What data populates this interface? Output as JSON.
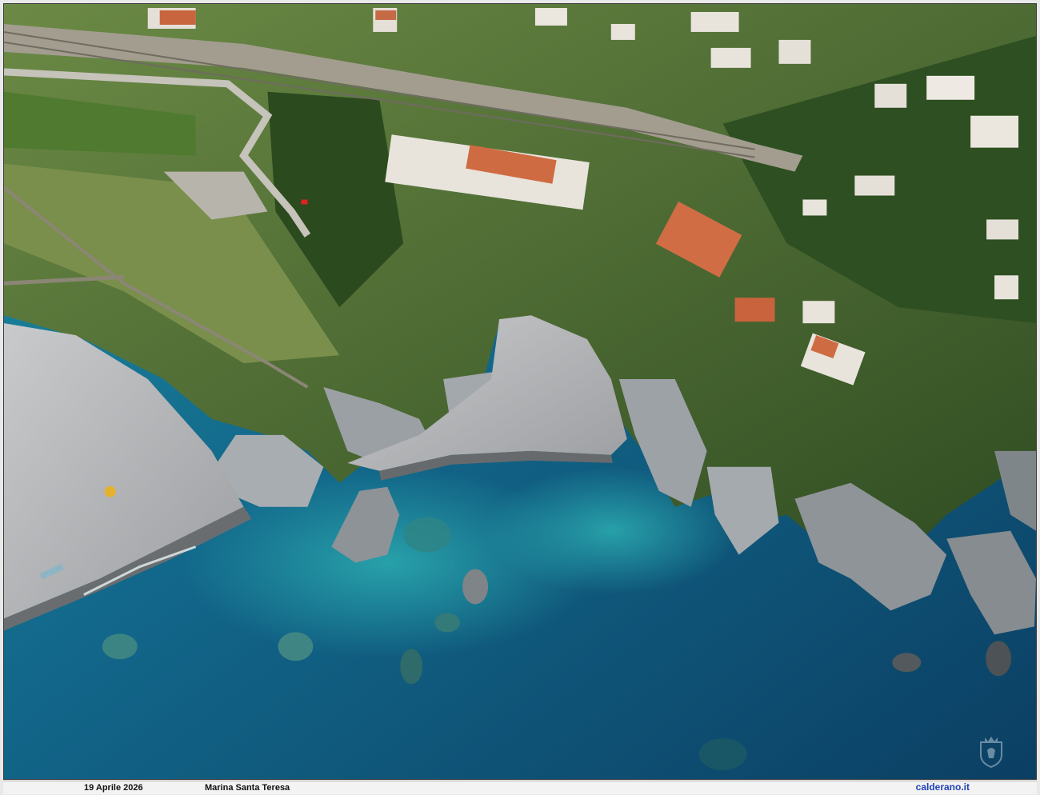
{
  "caption": {
    "date": "19 Aprile 2026",
    "place": "Marina Santa Teresa",
    "site": "calderano.it"
  },
  "photo": {
    "subject": "aerial",
    "palette": {
      "sea_deep": "#0d4f70",
      "sea_shallow": "#1c8ea6",
      "reef": "#3a8f8f",
      "sand": "#b8b9bb",
      "rock": "#9aa0a3",
      "vegetation": "#3c5e2a",
      "roofs": "#c8653d",
      "walls": "#e8e4dc",
      "rail": "#9b9688"
    }
  },
  "watermark": {
    "icon": "coat-of-arms-icon"
  }
}
